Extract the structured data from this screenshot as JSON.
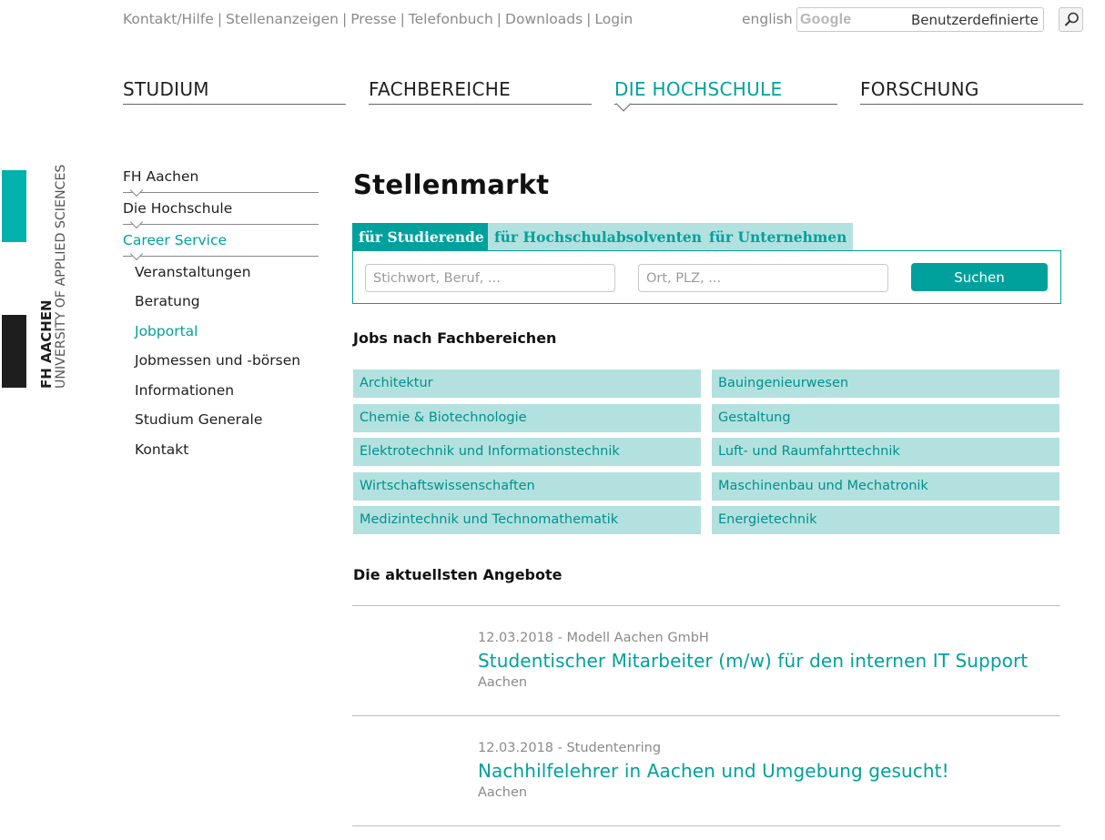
{
  "brand": {
    "line1": "FH AACHEN",
    "line2": "UNIVERSITY OF APPLIED SCIENCES",
    "teal": "#00b1ac",
    "black": "#1e1e1e"
  },
  "top_links": [
    "Kontakt/Hilfe",
    "Stellenanzeigen",
    "Presse",
    "Telefonbuch",
    "Downloads",
    "Login"
  ],
  "lang": "english",
  "site_search": {
    "brand": "Google",
    "placeholder": "Benutzerdefinierte Suche",
    "icon": "magnifier-icon"
  },
  "main_nav": [
    {
      "label": "STUDIUM",
      "active": false
    },
    {
      "label": "FACHBEREICHE",
      "active": false
    },
    {
      "label": "DIE HOCHSCHULE",
      "active": true
    },
    {
      "label": "FORSCHUNG",
      "active": false
    }
  ],
  "side_nav": {
    "level1": [
      {
        "label": "FH Aachen",
        "active": false
      },
      {
        "label": "Die Hochschule",
        "active": false
      },
      {
        "label": "Career Service",
        "active": true
      }
    ],
    "level2": [
      {
        "label": "Veranstaltungen",
        "active": false
      },
      {
        "label": "Beratung",
        "active": false
      },
      {
        "label": "Jobportal",
        "active": true
      },
      {
        "label": "Jobmessen und -börsen",
        "active": false
      },
      {
        "label": "Informationen",
        "active": false
      },
      {
        "label": "Studium Generale",
        "active": false
      },
      {
        "label": "Kontakt",
        "active": false
      }
    ]
  },
  "page_title": "Stellenmarkt",
  "tabs": [
    {
      "label": "für Studierende",
      "active": true
    },
    {
      "label": "für Hochschulabsolventen",
      "active": false
    },
    {
      "label": "für Unternehmen",
      "active": false
    }
  ],
  "job_search": {
    "keyword_placeholder": "Stichwort, Beruf, ...",
    "location_placeholder": "Ort, PLZ, ...",
    "button": "Suchen"
  },
  "categories_title": "Jobs nach Fachbereichen",
  "categories": [
    "Architektur",
    "Bauingenieurwesen",
    "Chemie & Biotechnologie",
    "Gestaltung",
    "Elektrotechnik und Informationstechnik",
    "Luft- und Raumfahrttechnik",
    "Wirtschaftswissenschaften",
    "Maschinenbau und Mechatronik",
    "Medizintechnik und Technomathematik",
    "Energietechnik"
  ],
  "offers_title": "Die aktuellsten Angebote",
  "offers": [
    {
      "meta": "12.03.2018 - Modell Aachen GmbH",
      "title": "Studentischer Mitarbeiter (m/w) für den internen IT Support",
      "location": "Aachen"
    },
    {
      "meta": "12.03.2018 - Studentenring",
      "title": "Nachhilfelehrer in Aachen und Umgebung gesucht!",
      "location": "Aachen"
    }
  ],
  "colors": {
    "accent": "#00a19c",
    "accent_light": "#b3e1df",
    "text": "#1e1e1e",
    "muted": "#8a8a8a"
  }
}
